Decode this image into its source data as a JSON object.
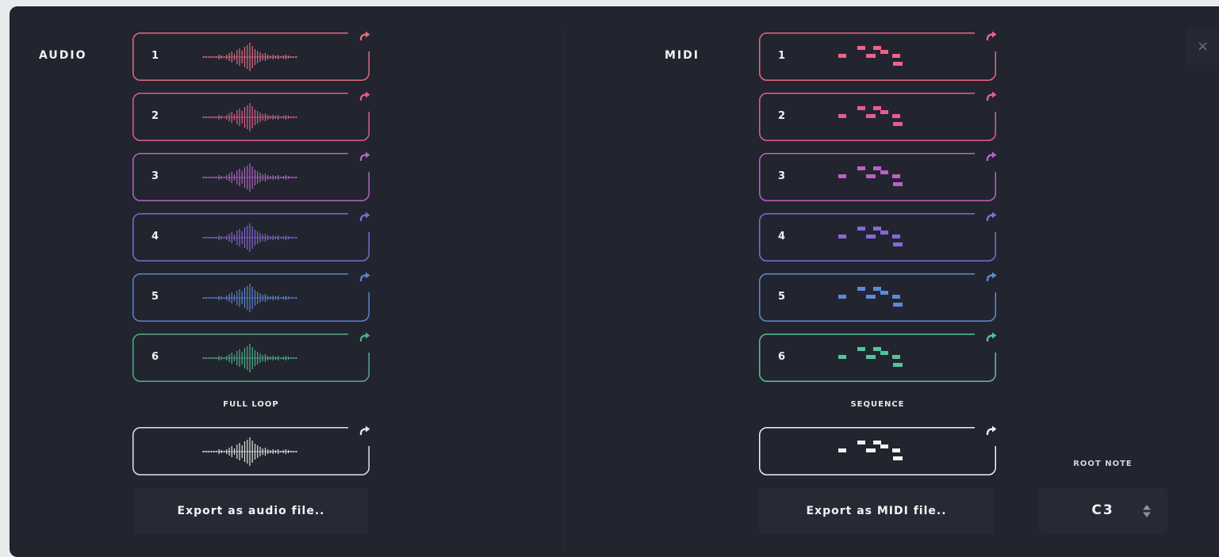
{
  "audio": {
    "title": "AUDIO",
    "stems": [
      {
        "label": "1",
        "color": "#e06b84"
      },
      {
        "label": "2",
        "color": "#dc5e8e"
      },
      {
        "label": "3",
        "color": "#b063c2"
      },
      {
        "label": "4",
        "color": "#8465d4"
      },
      {
        "label": "5",
        "color": "#5c83cf"
      },
      {
        "label": "6",
        "color": "#4fae88"
      }
    ],
    "full_label": "FULL LOOP",
    "full_color": "#e3e3e3",
    "export_label": "Export as audio file.."
  },
  "midi": {
    "title": "MIDI",
    "stems": [
      {
        "label": "1",
        "color": "#f0638a"
      },
      {
        "label": "2",
        "color": "#e65c93"
      },
      {
        "label": "3",
        "color": "#be5fcb"
      },
      {
        "label": "4",
        "color": "#8a66db"
      },
      {
        "label": "5",
        "color": "#5d8ad8"
      },
      {
        "label": "6",
        "color": "#55c39a"
      }
    ],
    "full_label": "SEQUENCE",
    "full_color": "#f2f2f2",
    "export_label": "Export as MIDI file.."
  },
  "root_note": {
    "label": "ROOT NOTE",
    "value": "C3"
  },
  "close": {
    "label": "×"
  },
  "icons": {
    "drag": "share-arrow-icon",
    "stepper": "up-down-stepper-icon",
    "close": "close-icon"
  }
}
